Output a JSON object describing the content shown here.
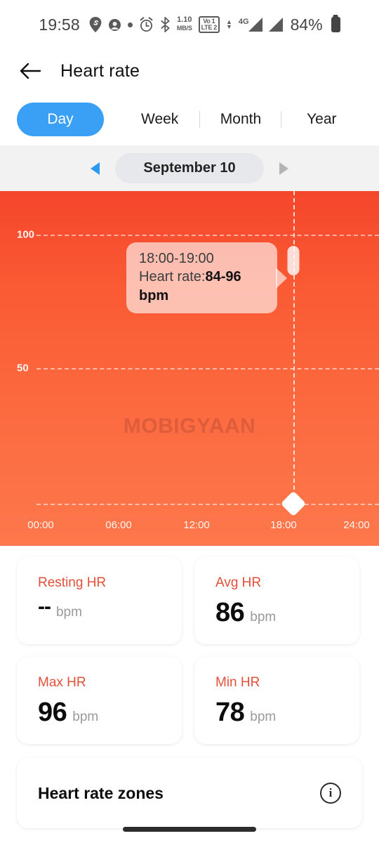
{
  "status_bar": {
    "time": "19:58",
    "network_speed_value": "1.10",
    "network_speed_unit": "MB/S",
    "volte_top": "Vo 1",
    "volte_bottom": "LTE 2",
    "network_type": "4G",
    "battery_percent": "84%",
    "icons": [
      "location-icon",
      "app-badge-icon",
      "dot-icon",
      "alarm-icon",
      "bluetooth-icon"
    ]
  },
  "app_bar": {
    "back_label": "back-arrow",
    "title": "Heart rate"
  },
  "tabs": {
    "items": [
      {
        "label": "Day",
        "active": true
      },
      {
        "label": "Week",
        "active": false
      },
      {
        "label": "Month",
        "active": false
      },
      {
        "label": "Year",
        "active": false
      }
    ],
    "active_color": "#39a0f5"
  },
  "date_nav": {
    "prev": "previous-day",
    "next": "next-day",
    "date": "September 10"
  },
  "chart_data": {
    "type": "bar",
    "title": "Heart rate",
    "xlabel": "",
    "ylabel": "bpm",
    "x_tick_labels": [
      "00:00",
      "06:00",
      "12:00",
      "18:00",
      "24:00"
    ],
    "x_tick_hours": [
      0,
      6,
      12,
      18,
      24
    ],
    "y_tick_labels": [
      "100",
      "50"
    ],
    "y_ticks": [
      100,
      50
    ],
    "ylim": [
      0,
      125
    ],
    "xlim": [
      0,
      24
    ],
    "grid": true,
    "gridlines_dashed": true,
    "background_gradient": [
      "#f5462b",
      "#fd784c"
    ],
    "series": [
      {
        "name": "Heart rate range",
        "x_hour": 18,
        "low": 84,
        "high": 96
      }
    ],
    "selected_point": {
      "time_range": "18:00-19:00",
      "label": "Heart rate:",
      "value": "84-96 bpm",
      "x_hour": 18,
      "low": 84,
      "high": 96
    },
    "marker": {
      "x_hour": 18,
      "shape": "diamond",
      "color": "#ffffff"
    },
    "watermark": "MOBIGYAAN"
  },
  "tooltip": {
    "time_range": "18:00-19:00",
    "metric_label": "Heart rate:",
    "value": "84-96 bpm"
  },
  "stats": [
    {
      "label": "Resting HR",
      "value": "--",
      "unit": "bpm",
      "is_dash": true
    },
    {
      "label": "Avg HR",
      "value": "86",
      "unit": "bpm",
      "is_dash": false
    },
    {
      "label": "Max HR",
      "value": "96",
      "unit": "bpm",
      "is_dash": false
    },
    {
      "label": "Min HR",
      "value": "78",
      "unit": "bpm",
      "is_dash": false
    }
  ],
  "zones": {
    "title": "Heart rate zones",
    "info": "i"
  },
  "colors": {
    "accent_blue": "#39a0f5",
    "stat_label_red": "#e2503a",
    "chart_top": "#f5462b",
    "chart_bottom": "#fd784c",
    "page_bg": "#f2f2f2"
  }
}
